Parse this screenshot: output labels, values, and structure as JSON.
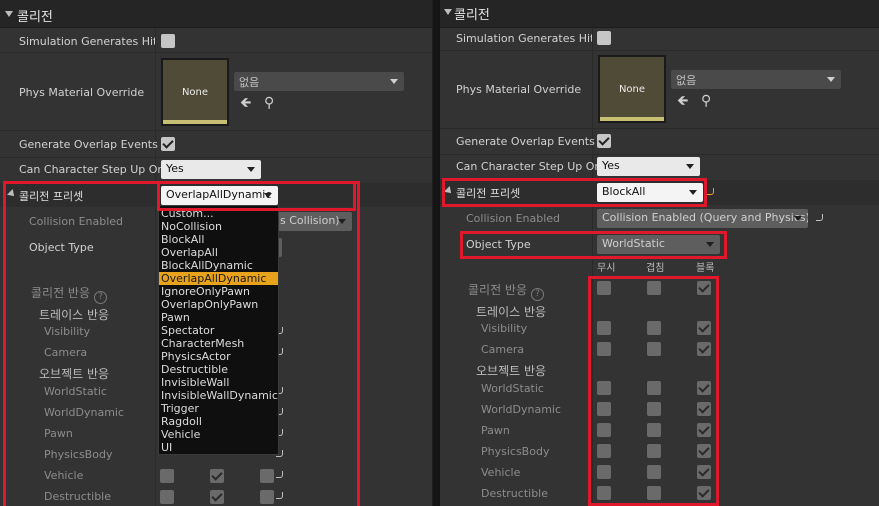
{
  "left": {
    "category_title": "콜리전",
    "sim_label": "Simulation Generates Hit E",
    "phys_label": "Phys Material Override",
    "mat_thumb": "None",
    "mat_combo": "없음",
    "overlap_label": "Generate Overlap Events",
    "step_label": "Can Character Step Up On",
    "step_value": "Yes",
    "preset_label": "콜리전 프리셋",
    "preset_value": "OverlapAllDynamic",
    "enabled_label": "Collision Enabled",
    "enabled_value": "s Collision)",
    "objtype_label": "Object Type",
    "resp_label": "콜리전 반응",
    "trace_label": "트레이스 반응",
    "visibility": "Visibility",
    "camera": "Camera",
    "object_label": "오브젝트 반응",
    "worldstatic": "WorldStatic",
    "worlddynamic": "WorldDynamic",
    "pawn": "Pawn",
    "physicsbody": "PhysicsBody",
    "vehicle": "Vehicle",
    "destructible": "Destructible",
    "menu": [
      "Custom...",
      "NoCollision",
      "BlockAll",
      "OverlapAll",
      "BlockAllDynamic",
      "OverlapAllDynamic",
      "IgnoreOnlyPawn",
      "OverlapOnlyPawn",
      "Pawn",
      "Spectator",
      "CharacterMesh",
      "PhysicsActor",
      "Destructible",
      "InvisibleWall",
      "InvisibleWallDynamic",
      "Trigger",
      "Ragdoll",
      "Vehicle",
      "UI"
    ],
    "selected_item": "OverlapAllDynamic"
  },
  "right": {
    "category_title": "콜리전",
    "sim_label": "Simulation Generates Hit E",
    "phys_label": "Phys Material Override",
    "mat_thumb": "None",
    "mat_combo": "없음",
    "overlap_label": "Generate Overlap Events",
    "step_label": "Can Character Step Up On",
    "step_value": "Yes",
    "preset_label": "콜리전 프리셋",
    "preset_value": "BlockAll",
    "enabled_label": "Collision Enabled",
    "enabled_value": "Collision Enabled (Query and Physics)",
    "objtype_label": "Object Type",
    "objtype_value": "WorldStatic",
    "col_ignore": "무시",
    "col_overlap": "겹침",
    "col_block": "블록",
    "resp_label": "콜리전 반응",
    "trace_label": "트레이스 반응",
    "visibility": "Visibility",
    "camera": "Camera",
    "object_label": "오브젝트 반응",
    "worldstatic": "WorldStatic",
    "worlddynamic": "WorldDynamic",
    "pawn": "Pawn",
    "physicsbody": "PhysicsBody",
    "vehicle": "Vehicle",
    "destructible": "Destructible"
  },
  "colors": {
    "highlight": "#e0182b",
    "menu_selected": "#e8a21b",
    "panel_bg": "#333333"
  }
}
